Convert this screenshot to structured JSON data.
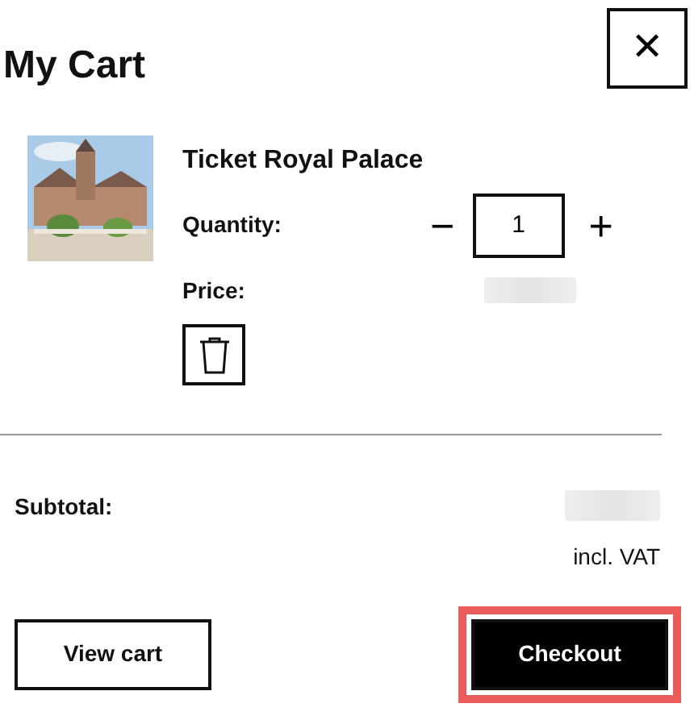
{
  "title": "My Cart",
  "close_button": {
    "label": "✕"
  },
  "items": [
    {
      "kind": "picture",
      "name": "Ticket Royal Palace",
      "quantity_label": "Quantity:",
      "quantity": "1",
      "minus": "−",
      "plus": "+",
      "price_label": "Price:",
      "price_redacted": true
    }
  ],
  "subtotal": {
    "label": "Subtotal:",
    "amount_redacted": true,
    "note": "incl. VAT"
  },
  "buttons": [
    {
      "label": "View cart",
      "kind": "outline",
      "focused": false
    },
    {
      "label": "Checkout",
      "kind": "dark",
      "focused": true
    }
  ]
}
